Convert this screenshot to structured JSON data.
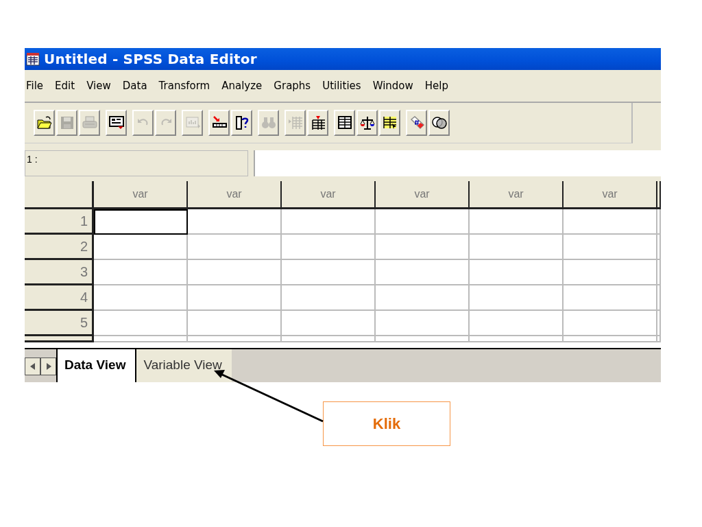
{
  "window": {
    "title": "Untitled - SPSS Data Editor"
  },
  "menu": [
    "File",
    "Edit",
    "View",
    "Data",
    "Transform",
    "Analyze",
    "Graphs",
    "Utilities",
    "Window",
    "Help"
  ],
  "toolbar": [
    [
      {
        "kind": "open",
        "disabled": false
      },
      {
        "kind": "save",
        "disabled": true
      },
      {
        "kind": "print",
        "disabled": true
      }
    ],
    [
      {
        "kind": "dialog",
        "disabled": false
      }
    ],
    [
      {
        "kind": "undo",
        "disabled": true
      },
      {
        "kind": "redo",
        "disabled": true
      }
    ],
    [
      {
        "kind": "chart",
        "disabled": true
      }
    ],
    [
      {
        "kind": "goto",
        "disabled": false
      },
      {
        "kind": "varinfo",
        "disabled": false
      }
    ],
    [
      {
        "kind": "find",
        "disabled": true
      }
    ],
    [
      {
        "kind": "insertcase",
        "disabled": true
      },
      {
        "kind": "insertvar",
        "disabled": false
      }
    ],
    [
      {
        "kind": "split",
        "disabled": false
      },
      {
        "kind": "weight",
        "disabled": false
      },
      {
        "kind": "select",
        "disabled": false
      }
    ],
    [
      {
        "kind": "labels",
        "disabled": false
      },
      {
        "kind": "sets",
        "disabled": false
      }
    ]
  ],
  "cell_ref": "1 :",
  "grid": {
    "columns": [
      "var",
      "var",
      "var",
      "var",
      "var",
      "var"
    ],
    "rows": [
      {
        "label": "1",
        "cells": [
          {
            "selected": true
          },
          {
            "selected": false
          },
          {
            "selected": false
          },
          {
            "selected": false
          },
          {
            "selected": false
          },
          {
            "selected": false
          }
        ]
      },
      {
        "label": "2",
        "cells": [
          {
            "selected": false
          },
          {
            "selected": false
          },
          {
            "selected": false
          },
          {
            "selected": false
          },
          {
            "selected": false
          },
          {
            "selected": false
          }
        ]
      },
      {
        "label": "3",
        "cells": [
          {
            "selected": false
          },
          {
            "selected": false
          },
          {
            "selected": false
          },
          {
            "selected": false
          },
          {
            "selected": false
          },
          {
            "selected": false
          }
        ]
      },
      {
        "label": "4",
        "cells": [
          {
            "selected": false
          },
          {
            "selected": false
          },
          {
            "selected": false
          },
          {
            "selected": false
          },
          {
            "selected": false
          },
          {
            "selected": false
          }
        ]
      },
      {
        "label": "5",
        "cells": [
          {
            "selected": false
          },
          {
            "selected": false
          },
          {
            "selected": false
          },
          {
            "selected": false
          },
          {
            "selected": false
          },
          {
            "selected": false
          }
        ]
      }
    ]
  },
  "tabs": [
    {
      "label": "Data View",
      "selected": true
    },
    {
      "label": "Variable View",
      "selected": false
    }
  ],
  "callout": {
    "text": "Klik"
  }
}
